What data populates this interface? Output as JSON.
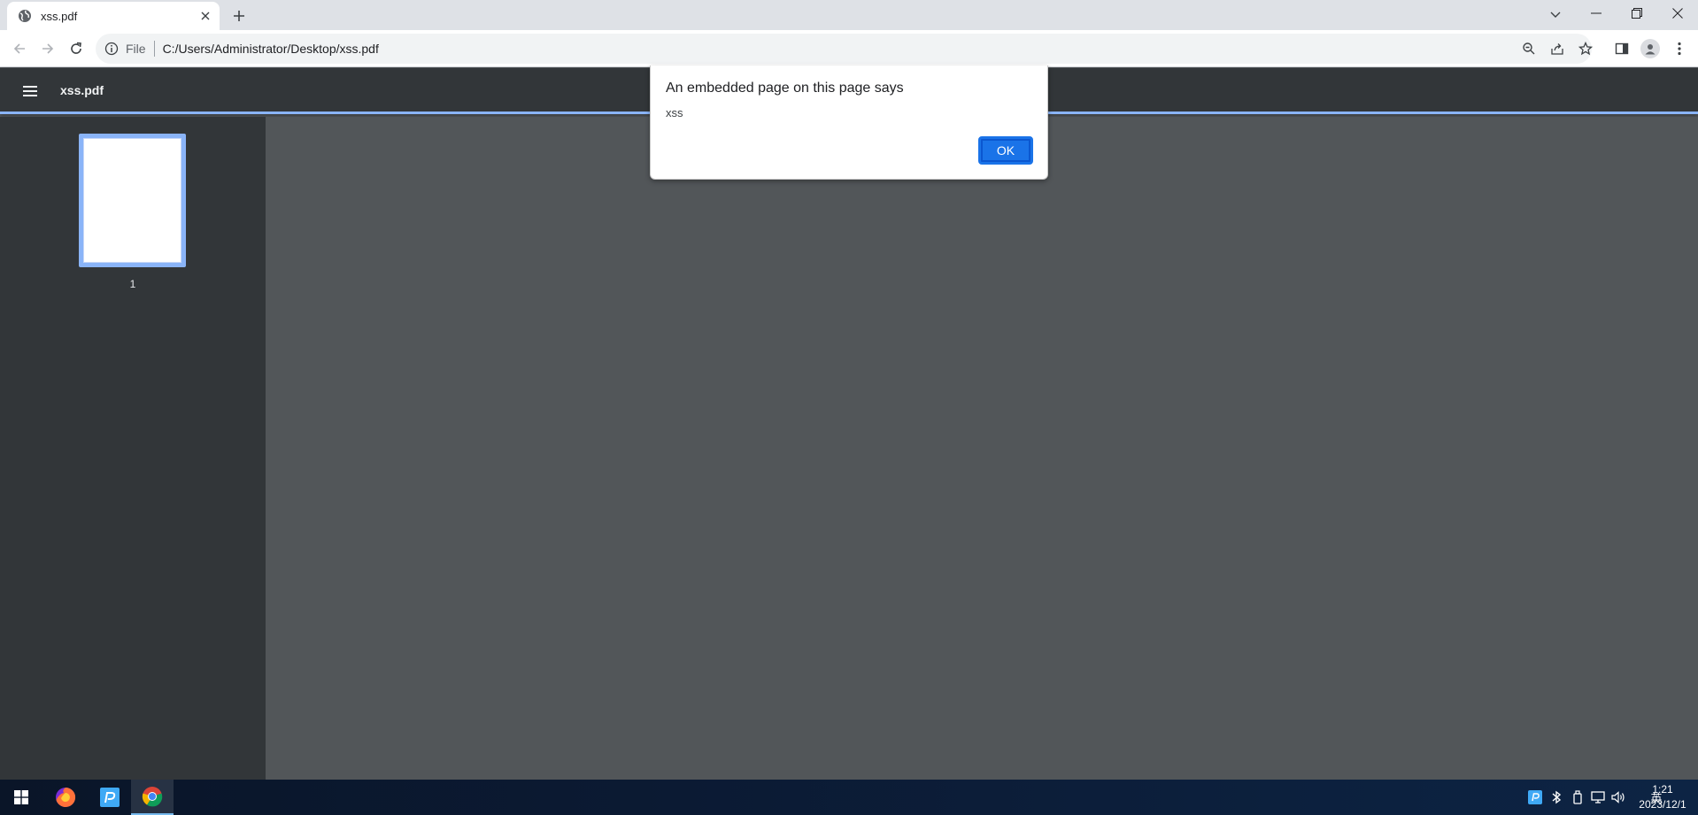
{
  "browser": {
    "tab": {
      "title": "xss.pdf",
      "favicon": "globe-icon"
    },
    "address": {
      "scheme": "File",
      "url": "C:/Users/Administrator/Desktop/xss.pdf"
    },
    "window_controls": [
      "minimize",
      "restore",
      "close"
    ]
  },
  "pdf_viewer": {
    "title": "xss.pdf",
    "thumbnails": [
      {
        "page": "1"
      }
    ]
  },
  "dialog": {
    "title": "An embedded page on this page says",
    "message": "xss",
    "ok_label": "OK"
  },
  "taskbar": {
    "apps": [
      "windows-start",
      "firefox",
      "pdf-editor",
      "chrome"
    ],
    "tray": {
      "ime_label": "英"
    },
    "clock": {
      "time": "1:21",
      "date": "2023/12/1"
    }
  },
  "colors": {
    "accent": "#1a73e8",
    "pdf_header": "#323639",
    "pdf_background": "#525659",
    "thumbnail_highlight": "#8ab4f8"
  }
}
